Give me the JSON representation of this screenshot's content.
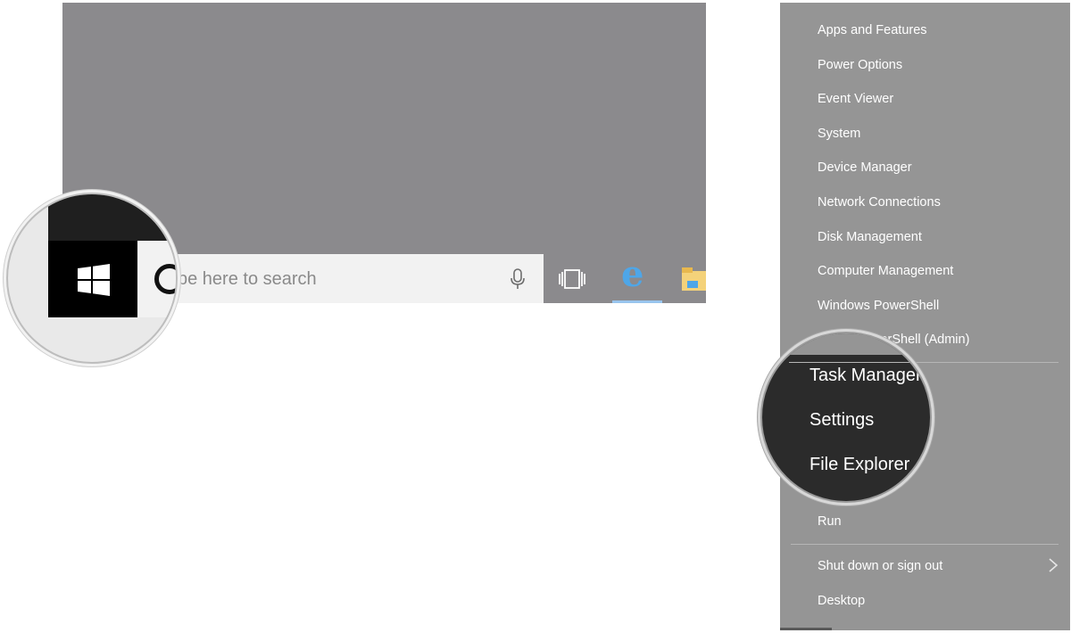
{
  "taskbar": {
    "search_placeholder": "Type here to search",
    "magnified_search_fragment": "ype here to search"
  },
  "menu": {
    "items": [
      {
        "label": "Apps and Features"
      },
      {
        "label": "Power Options"
      },
      {
        "label": "Event Viewer"
      },
      {
        "label": "System"
      },
      {
        "label": "Device Manager"
      },
      {
        "label": "Network Connections"
      },
      {
        "label": "Disk Management"
      },
      {
        "label": "Computer Management"
      },
      {
        "label": "Windows PowerShell"
      },
      {
        "label": "werShell (Admin)"
      },
      {
        "label": "Run"
      },
      {
        "label": "Shut down or sign out"
      },
      {
        "label": "Desktop"
      }
    ],
    "magnified": [
      {
        "label": "Task Manager"
      },
      {
        "label": "Settings"
      },
      {
        "label": "File Explorer"
      }
    ],
    "magnified_peek": "PowerShell"
  },
  "colors": {
    "desktop": "#8b8a8d",
    "menu_bg": "#959595",
    "edge_blue": "#4ea6e8",
    "start_black": "#000000"
  },
  "icons": {
    "start": "windows-logo-icon",
    "cortana": "cortana-ring-icon",
    "mic": "microphone-icon",
    "task_view": "task-view-icon",
    "edge": "edge-browser-icon",
    "folder": "file-explorer-folder-icon",
    "submenu": "chevron-right-icon"
  }
}
